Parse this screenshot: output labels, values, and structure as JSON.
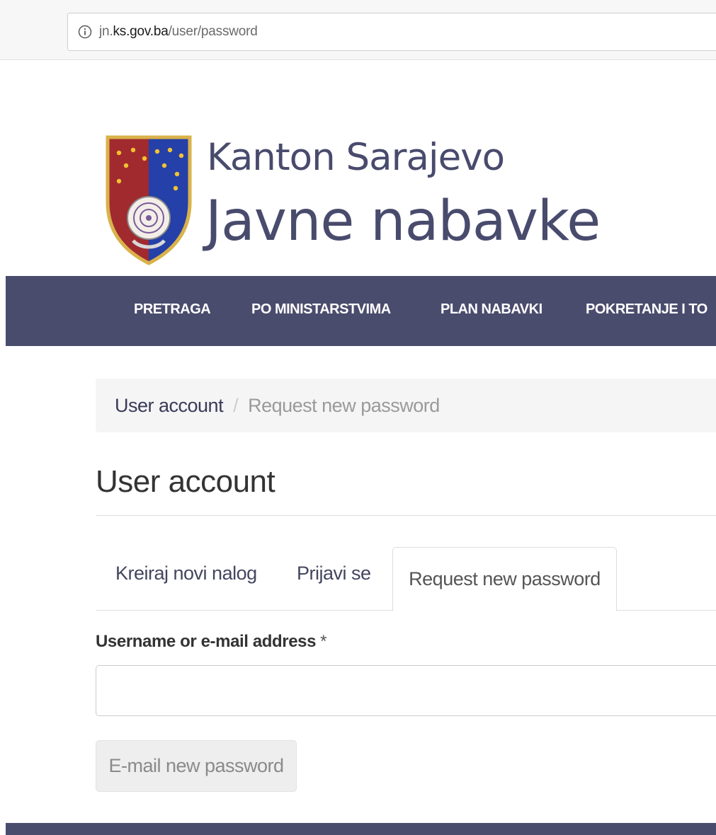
{
  "browser": {
    "url_prefix": "jn.",
    "url_domain": "ks.gov.ba",
    "url_path": "/user/password"
  },
  "header": {
    "site_name_line1": "Kanton Sarajevo",
    "site_name_line2": "Javne nabavke"
  },
  "nav": {
    "items": [
      {
        "label": "PRETRAGA"
      },
      {
        "label": "PO MINISTARSTVIMA"
      },
      {
        "label": "PLAN NABAVKI"
      },
      {
        "label": "POKRETANJE I TO"
      }
    ]
  },
  "breadcrumb": {
    "items": [
      {
        "label": "User account"
      },
      {
        "label": "Request new password"
      }
    ],
    "separator": "/"
  },
  "page": {
    "title": "User account"
  },
  "tabs": [
    {
      "label": "Kreiraj novi nalog",
      "active": false
    },
    {
      "label": "Prijavi se",
      "active": false
    },
    {
      "label": "Request new password",
      "active": true
    }
  ],
  "form": {
    "field_label": "Username or e-mail address",
    "required_marker": "*",
    "field_value": "",
    "submit_label": "E-mail new password"
  },
  "colors": {
    "brand_navy": "#4a4c6d",
    "logo_text": "#494b6d",
    "breadcrumb_bg": "#f5f5f5"
  },
  "icons": {
    "address_bar": "info-icon",
    "logo": "coat-of-arms-icon"
  }
}
